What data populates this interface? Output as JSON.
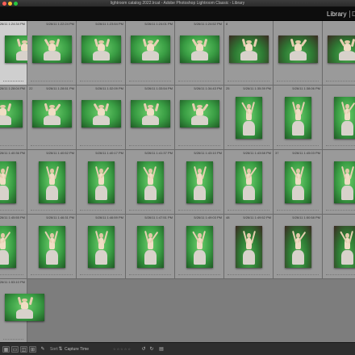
{
  "window": {
    "title": "lightroom catalog 2022.lrcat - Adobe Photoshop Lightroom Classic - Library",
    "traffic_colors": [
      "#ff5f57",
      "#febc2e",
      "#28c840"
    ]
  },
  "modules": {
    "active": "Library",
    "next_partial": "D"
  },
  "grid": {
    "columns": 7,
    "rows": [
      [
        {
          "num": "",
          "ts": "5/26/11 1:24:34 PM",
          "photo": "bg-wide",
          "selected": true
        },
        {
          "num": "",
          "ts": "5/26/11 1:22:24 PM",
          "photo": "bg-wide"
        },
        {
          "num": "",
          "ts": "5/26/11 1:23:54 PM",
          "photo": "bg-wide"
        },
        {
          "num": "",
          "ts": "5/26/11 1:24:01 PM",
          "photo": "bg-wide"
        },
        {
          "num": "",
          "ts": "5/26/11 1:24:52 PM",
          "photo": "bg-wide"
        },
        {
          "num": "8",
          "ts": "",
          "photo": "room-wide"
        },
        {
          "num": "",
          "ts": "",
          "photo": "room-wide"
        },
        {
          "num": "",
          "ts": "",
          "photo": "room-wide"
        }
      ],
      [
        {
          "num": "",
          "ts": "5/26/11 1:28:04 PM",
          "photo": "bg-wide"
        },
        {
          "num": "22",
          "ts": "5/26/11 1:28:51 PM",
          "photo": "bg-wide"
        },
        {
          "num": "",
          "ts": "5/26/11 1:32:09 PM",
          "photo": "bg-wide"
        },
        {
          "num": "",
          "ts": "5/26/11 1:33:54 PM",
          "photo": "bg-wide"
        },
        {
          "num": "",
          "ts": "5/26/11 1:34:43 PM",
          "photo": "bg-wide"
        },
        {
          "num": "25",
          "ts": "5/26/11 1:35:39 PM",
          "photo": "bg-tall"
        },
        {
          "num": "",
          "ts": "5/26/11 1:38:06 PM",
          "photo": "bg-tall"
        },
        {
          "num": "",
          "ts": "",
          "photo": "bg-tall"
        }
      ],
      [
        {
          "num": "",
          "ts": "5/26/11 1:40:36 PM",
          "photo": "bg-tall"
        },
        {
          "num": "",
          "ts": "5/26/11 1:40:52 PM",
          "photo": "bg-tall"
        },
        {
          "num": "",
          "ts": "5/26/11 1:40:17 PM",
          "photo": "bg-tall"
        },
        {
          "num": "",
          "ts": "5/26/11 1:41:37 PM",
          "photo": "bg-tall"
        },
        {
          "num": "",
          "ts": "5/26/11 1:43:10 PM",
          "photo": "bg-tall"
        },
        {
          "num": "",
          "ts": "5/26/11 1:43:58 PM",
          "photo": "bg-tall"
        },
        {
          "num": "37",
          "ts": "5/26/11 1:45:03 PM",
          "photo": "bg-tall"
        },
        {
          "num": "",
          "ts": "",
          "photo": "bg-tall"
        }
      ],
      [
        {
          "num": "",
          "ts": "5/26/11 1:45:55 PM",
          "photo": "bg-tall"
        },
        {
          "num": "",
          "ts": "5/26/11 1:46:31 PM",
          "photo": "bg-tall"
        },
        {
          "num": "",
          "ts": "5/26/11 1:46:59 PM",
          "photo": "bg-tall"
        },
        {
          "num": "",
          "ts": "5/26/11 1:47:51 PM",
          "photo": "bg-tall"
        },
        {
          "num": "",
          "ts": "5/26/11 1:49:03 PM",
          "photo": "bg-tall"
        },
        {
          "num": "48",
          "ts": "5/26/11 1:49:52 PM",
          "photo": "room-tall"
        },
        {
          "num": "",
          "ts": "5/26/11 1:50:58 PM",
          "photo": "room-tall"
        },
        {
          "num": "",
          "ts": "",
          "photo": "room-tall"
        }
      ],
      [
        {
          "num": "",
          "ts": "5/26/11 1:53:10 PM",
          "photo": "bg-wide"
        }
      ]
    ]
  },
  "statusbar": {
    "sort_label": "Capture Time",
    "icons": [
      "grid-view-icon",
      "loupe-view-icon",
      "compare-view-icon",
      "survey-view-icon",
      "people-view-icon",
      "painter-icon",
      "sort-direction-icon"
    ],
    "rating_dots": "☆☆☆☆☆"
  }
}
